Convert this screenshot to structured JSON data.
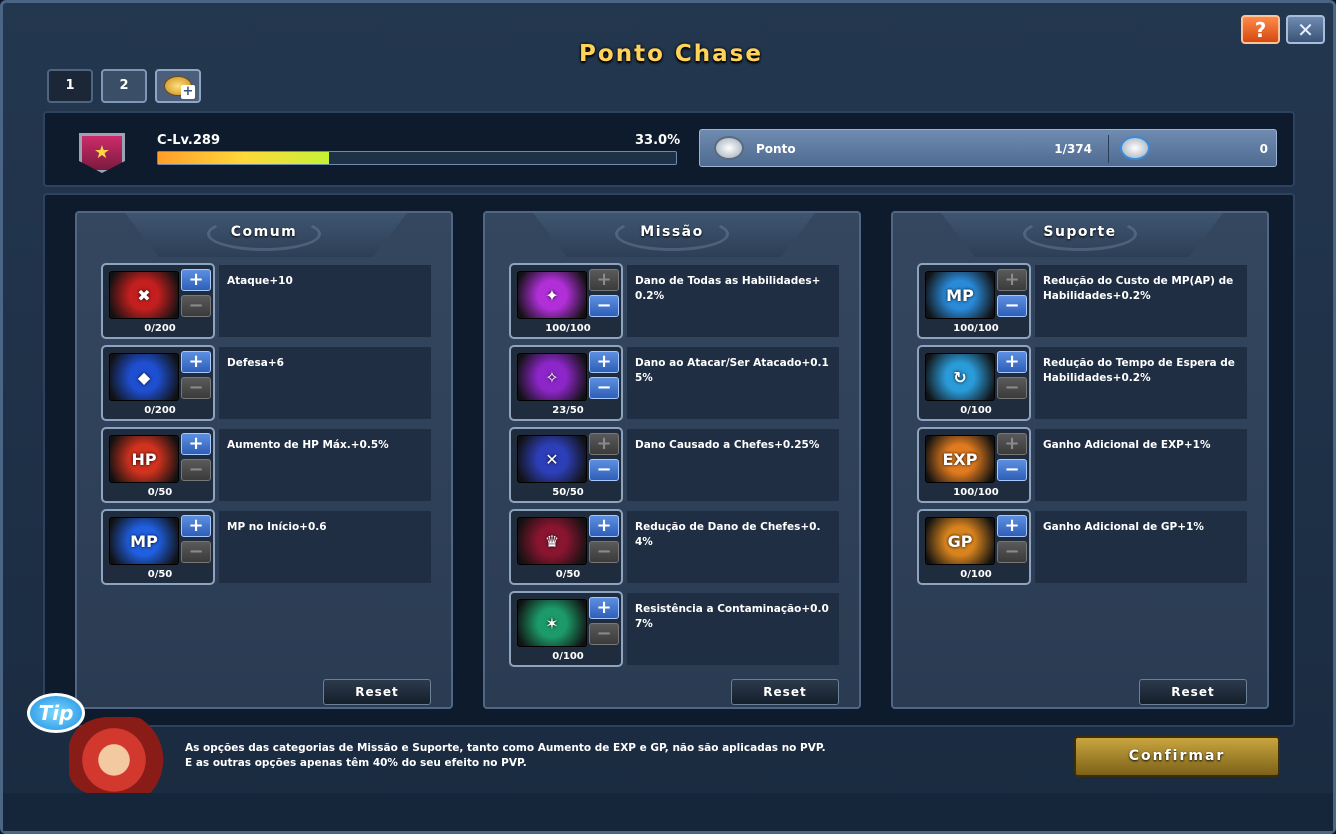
{
  "window": {
    "title": "Ponto Chase",
    "help_label": "?",
    "close_label": "✕"
  },
  "tabs": [
    {
      "label": "1"
    },
    {
      "label": "2"
    },
    {
      "label": "+"
    }
  ],
  "level": {
    "label": "C-Lv.289",
    "percent_text": "33.0%",
    "progress": 0.33
  },
  "points": {
    "label": "Ponto",
    "value": "1/374",
    "reset_count": "0"
  },
  "panels": [
    {
      "title": "Comum",
      "reset_label": "Reset",
      "skills": [
        {
          "name": "Ataque+10",
          "count": "0/200",
          "icon": "attack-icon",
          "icon_text": "✖",
          "color": "#c41f1f"
        },
        {
          "name": "Defesa+6",
          "count": "0/200",
          "icon": "defense-icon",
          "icon_text": "◆",
          "color": "#1e4fd1"
        },
        {
          "name": "Aumento de HP Máx.+0.5%",
          "count": "0/50",
          "icon": "hp-icon",
          "icon_text": "HP",
          "color": "#d1321e"
        },
        {
          "name": "MP no Início+0.6",
          "count": "0/50",
          "icon": "mp-icon",
          "icon_text": "MP",
          "color": "#1f5fe0"
        }
      ]
    },
    {
      "title": "Missão",
      "reset_label": "Reset",
      "skills": [
        {
          "name": "Dano de Todas as Habilidades+0.2%",
          "count": "100/100",
          "icon": "all-skills-damage-icon",
          "icon_text": "✦",
          "color": "#b02fd8"
        },
        {
          "name": "Dano ao Atacar/Ser Atacado+0.15%",
          "count": "23/50",
          "icon": "shield-damage-icon",
          "icon_text": "✧",
          "color": "#8d26c9"
        },
        {
          "name": "Dano Causado a Chefes+0.25%",
          "count": "50/50",
          "icon": "boss-damage-icon",
          "icon_text": "✕",
          "color": "#2d3fb8"
        },
        {
          "name": "Redução de Dano de Chefes+0.4%",
          "count": "0/50",
          "icon": "boss-reduction-icon",
          "icon_text": "♛",
          "color": "#8a1530"
        },
        {
          "name": "Resistência a Contaminação+0.07%",
          "count": "0/100",
          "icon": "contamination-resist-icon",
          "icon_text": "✶",
          "color": "#1c9a6a"
        }
      ]
    },
    {
      "title": "Suporte",
      "reset_label": "Reset",
      "skills": [
        {
          "name": "Redução do Custo de MP(AP) de Habilidades+0.2%",
          "count": "100/100",
          "icon": "mp-cost-icon",
          "icon_text": "MP",
          "color": "#2a8ad8"
        },
        {
          "name": "Redução do Tempo de Espera de Habilidades+0.2%",
          "count": "0/100",
          "icon": "cooldown-icon",
          "icon_text": "↻",
          "color": "#2a9ad8"
        },
        {
          "name": "Ganho Adicional de EXP+1%",
          "count": "100/100",
          "icon": "exp-icon",
          "icon_text": "EXP",
          "color": "#e07a1e"
        },
        {
          "name": "Ganho Adicional de GP+1%",
          "count": "0/100",
          "icon": "gp-icon",
          "icon_text": "GP",
          "color": "#d8841e"
        }
      ]
    }
  ],
  "notes": {
    "line1": "As opções das categorias de Missão e Suporte, tanto como Aumento de EXP e GP, não são aplicadas no PVP.",
    "line2": "E as outras opções apenas têm 40% do seu efeito no PVP."
  },
  "tip_label": "Tip",
  "confirm_label": "Confirmar"
}
